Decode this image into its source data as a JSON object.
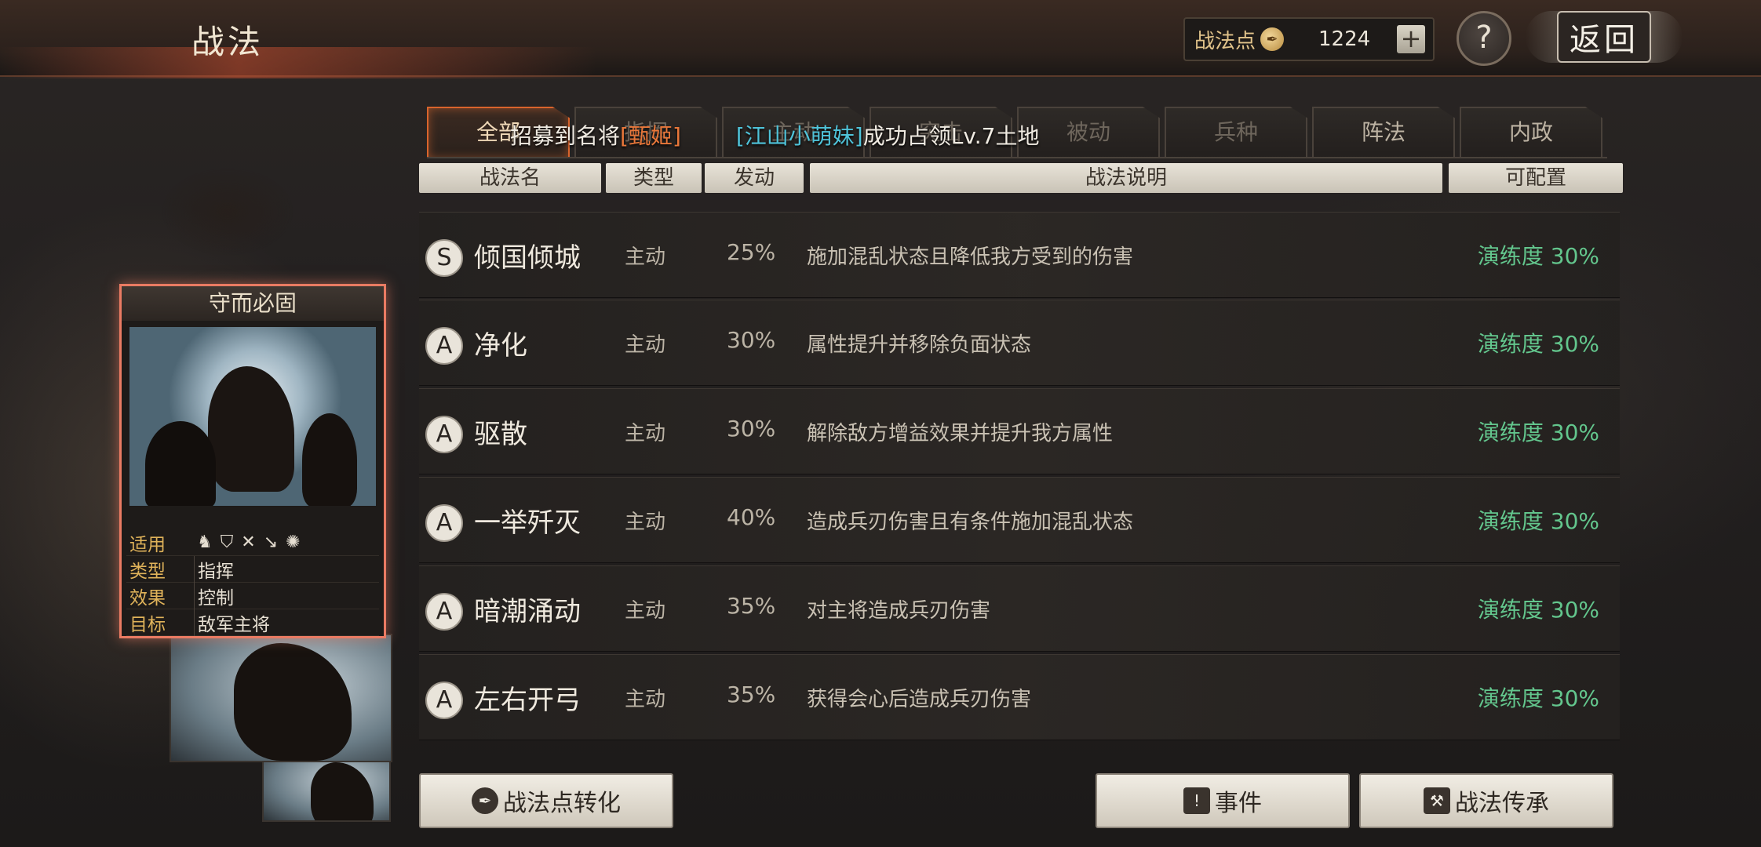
{
  "header": {
    "title": "战法",
    "points_label": "战法点",
    "points_value": "1224",
    "add_label": "+",
    "help_label": "?",
    "back_label": "返回"
  },
  "tabs": [
    {
      "label": "全部",
      "active": true
    },
    {
      "label": "指挥",
      "active": false
    },
    {
      "label": "主动",
      "active": false
    },
    {
      "label": "突击",
      "active": false
    },
    {
      "label": "被动",
      "active": false
    },
    {
      "label": "兵种",
      "active": false
    },
    {
      "label": "阵法",
      "active": false
    },
    {
      "label": "内政",
      "active": false
    }
  ],
  "marquee": {
    "prefix": "招募到名将",
    "recruit_name": "[甄姬]",
    "player_name": "[江山小萌妹]",
    "suffix": "成功占领Lv.7土地"
  },
  "table_headers": {
    "name": "战法名",
    "type": "类型",
    "rate": "发动",
    "desc": "战法说明",
    "config": "可配置"
  },
  "tactics": [
    {
      "rank": "S",
      "name": "倾国倾城",
      "type": "主动",
      "rate": "25%",
      "desc": "施加混乱状态且降低我方受到的伤害",
      "proficiency": "演练度 30%"
    },
    {
      "rank": "A",
      "name": "净化",
      "type": "主动",
      "rate": "30%",
      "desc": "属性提升并移除负面状态",
      "proficiency": "演练度 30%"
    },
    {
      "rank": "A",
      "name": "驱散",
      "type": "主动",
      "rate": "30%",
      "desc": "解除敌方增益效果并提升我方属性",
      "proficiency": "演练度 30%"
    },
    {
      "rank": "A",
      "name": "一举歼灭",
      "type": "主动",
      "rate": "40%",
      "desc": "造成兵刃伤害且有条件施加混乱状态",
      "proficiency": "演练度 30%"
    },
    {
      "rank": "A",
      "name": "暗潮涌动",
      "type": "主动",
      "rate": "35%",
      "desc": "对主将造成兵刃伤害",
      "proficiency": "演练度 30%"
    },
    {
      "rank": "A",
      "name": "左右开弓",
      "type": "主动",
      "rate": "35%",
      "desc": "获得会心后造成兵刃伤害",
      "proficiency": "演练度 30%"
    }
  ],
  "card": {
    "title": "守而必固",
    "applies_label": "适用",
    "applies_icons": [
      "cavalry-icon",
      "shield-icon",
      "archer-icon",
      "spear-icon",
      "siege-icon"
    ],
    "type_label": "类型",
    "type_value": "指挥",
    "effect_label": "效果",
    "effect_value": "控制",
    "target_label": "目标",
    "target_value": "敌军主将"
  },
  "buttons": {
    "convert": "战法点转化",
    "event": "事件",
    "inherit": "战法传承"
  },
  "colors": {
    "accent_orange": "#d9642c",
    "proficiency_green": "#63c68d",
    "recruit_name": "#e8773a",
    "player_name": "#4fc3d9",
    "card_border": "#ea7b63"
  }
}
